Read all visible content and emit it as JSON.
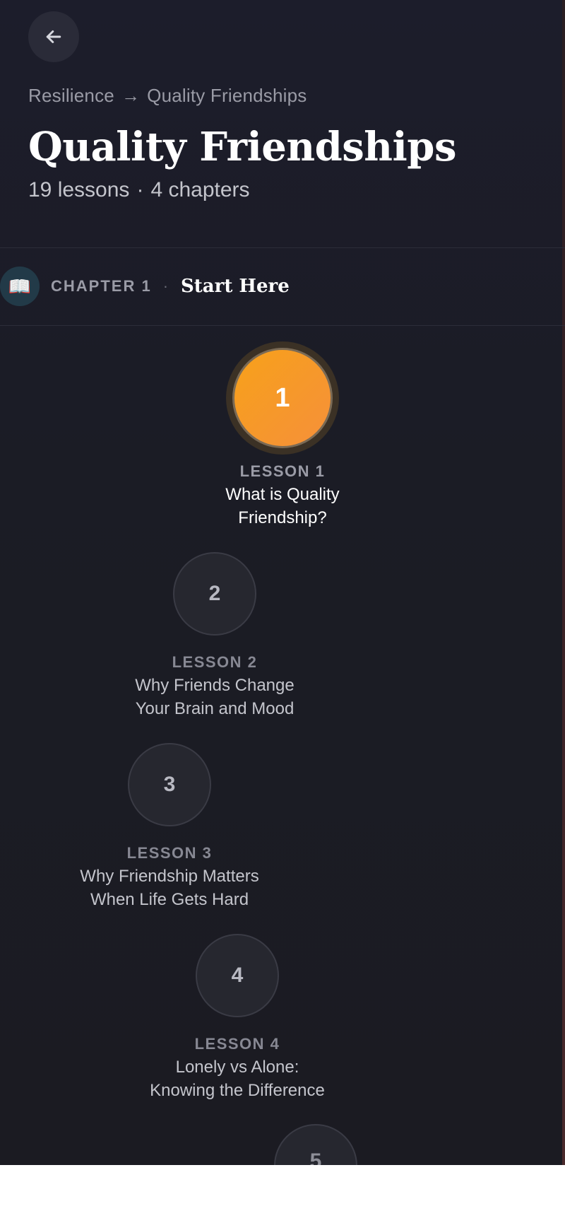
{
  "header": {
    "back_icon": "arrow-left-icon",
    "breadcrumb": {
      "parent": "Resilience",
      "separator": "→",
      "current": "Quality Friendships"
    },
    "title": "Quality Friendships",
    "stats": {
      "lessons": "19 lessons",
      "dot": "·",
      "chapters": "4 chapters"
    }
  },
  "chapter": {
    "icon": "📖",
    "icon_name": "open-book-icon",
    "label": "CHAPTER 1",
    "dot": "·",
    "name": "Start Here"
  },
  "lessons": [
    {
      "number": "1",
      "label": "LESSON 1",
      "title_line1": "What is Quality",
      "title_line2": "Friendship?",
      "state": "active"
    },
    {
      "number": "2",
      "label": "LESSON 2",
      "title_line1": "Why Friends Change",
      "title_line2": "Your Brain and Mood",
      "state": "locked"
    },
    {
      "number": "3",
      "label": "LESSON 3",
      "title_line1": "Why Friendship Matters",
      "title_line2": "When Life Gets Hard",
      "state": "locked"
    },
    {
      "number": "4",
      "label": "LESSON 4",
      "title_line1": "Lonely vs Alone:",
      "title_line2": "Knowing the Difference",
      "state": "locked"
    },
    {
      "number": "5",
      "state": "locked"
    }
  ],
  "colors": {
    "background": "#1c1d2b",
    "accent": "#f7a11a",
    "chapter_icon_bg": "#223a48"
  }
}
